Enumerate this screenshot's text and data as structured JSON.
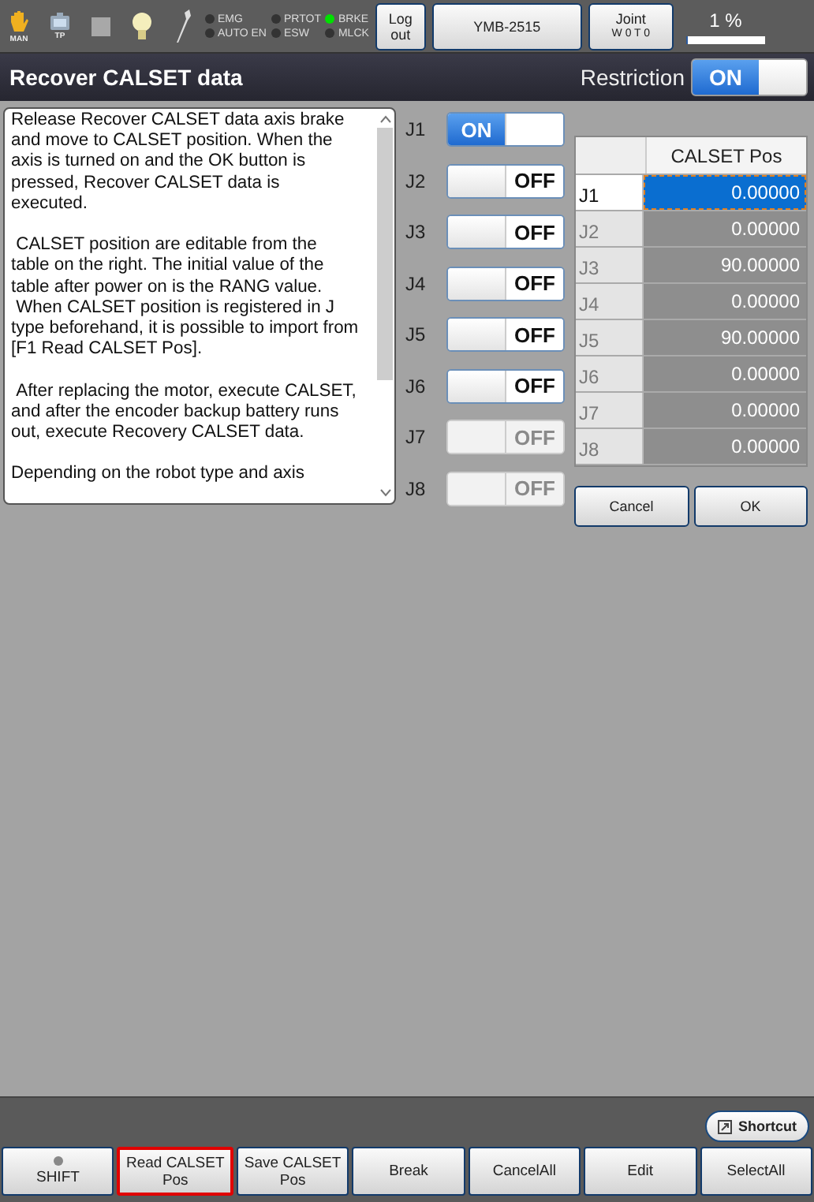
{
  "status_bar": {
    "mode_icons": [
      {
        "kind": "hand",
        "label": "MAN"
      },
      {
        "kind": "pendant",
        "label": "TP"
      },
      {
        "kind": "square"
      },
      {
        "kind": "bulb"
      },
      {
        "kind": "wrench"
      }
    ],
    "lamps": [
      {
        "label": "EMG",
        "on": false
      },
      {
        "label": "AUTO EN",
        "on": false
      },
      {
        "label": "PRTOT",
        "on": false
      },
      {
        "label": "ESW",
        "on": false
      },
      {
        "label": "BRKE",
        "on": true
      },
      {
        "label": "MLCK",
        "on": false
      }
    ],
    "logout_button": [
      "Log",
      "out"
    ],
    "robot_button": "YMB-2515",
    "coord_button": [
      "Joint",
      "W 0 T 0"
    ],
    "speed": {
      "reading": "1 %",
      "level": 0.02
    }
  },
  "title": "Recover CALSET data",
  "restriction": {
    "label": "Restriction",
    "on_label": "ON",
    "on": true
  },
  "description": [
    "Release Recover CALSET data axis brake and move to CALSET position. When the axis is turned on and the OK button is pressed, Recover CALSET data is executed.",
    " CALSET position are editable from the table on the right. The initial value of the table after power on is the RANG value.\n When CALSET position is registered in J type beforehand, it is possible to import from [F1 Read CALSET Pos].",
    " After replacing the motor, execute CALSET, and after the encoder backup battery runs out, execute Recovery CALSET data.",
    "Depending on the robot type and axis"
  ],
  "axes": [
    {
      "label": "J1",
      "text": "ON",
      "on": true,
      "disabled": false
    },
    {
      "label": "J2",
      "text": "OFF",
      "on": false,
      "disabled": false
    },
    {
      "label": "J3",
      "text": "OFF",
      "on": false,
      "disabled": false
    },
    {
      "label": "J4",
      "text": "OFF",
      "on": false,
      "disabled": false
    },
    {
      "label": "J5",
      "text": "OFF",
      "on": false,
      "disabled": false
    },
    {
      "label": "J6",
      "text": "OFF",
      "on": false,
      "disabled": false
    },
    {
      "label": "J7",
      "text": "OFF",
      "on": false,
      "disabled": true
    },
    {
      "label": "J8",
      "text": "OFF",
      "on": false,
      "disabled": true
    }
  ],
  "table": {
    "columns": [
      "CALSET Pos"
    ],
    "rows": [
      {
        "label": "J1",
        "value": "0.00000",
        "selected": true,
        "disabled": false
      },
      {
        "label": "J2",
        "value": "0.00000",
        "selected": false,
        "disabled": true
      },
      {
        "label": "J3",
        "value": "90.00000",
        "selected": false,
        "disabled": true
      },
      {
        "label": "J4",
        "value": "0.00000",
        "selected": false,
        "disabled": true
      },
      {
        "label": "J5",
        "value": "90.00000",
        "selected": false,
        "disabled": true
      },
      {
        "label": "J6",
        "value": "0.00000",
        "selected": false,
        "disabled": true
      },
      {
        "label": "J7",
        "value": "0.00000",
        "selected": false,
        "disabled": true
      },
      {
        "label": "J8",
        "value": "0.00000",
        "selected": false,
        "disabled": true
      }
    ]
  },
  "dialog_buttons": [
    "Cancel",
    "OK"
  ],
  "shortcut_button": "Shortcut",
  "function_keys": [
    {
      "lines": [
        "SHIFT"
      ],
      "kind": "lamp",
      "highlighted": false
    },
    {
      "lines": [
        "Read CALSET",
        "Pos"
      ],
      "kind": "plain",
      "highlighted": true
    },
    {
      "lines": [
        "Save CALSET",
        "Pos"
      ],
      "kind": "plain",
      "highlighted": false
    },
    {
      "lines": [
        "Break"
      ],
      "kind": "plain",
      "highlighted": false
    },
    {
      "lines": [
        "CancelAll"
      ],
      "kind": "plain",
      "highlighted": false
    },
    {
      "lines": [
        "Edit"
      ],
      "kind": "plain",
      "highlighted": false
    },
    {
      "lines": [
        "SelectAll"
      ],
      "kind": "plain",
      "highlighted": false
    }
  ]
}
